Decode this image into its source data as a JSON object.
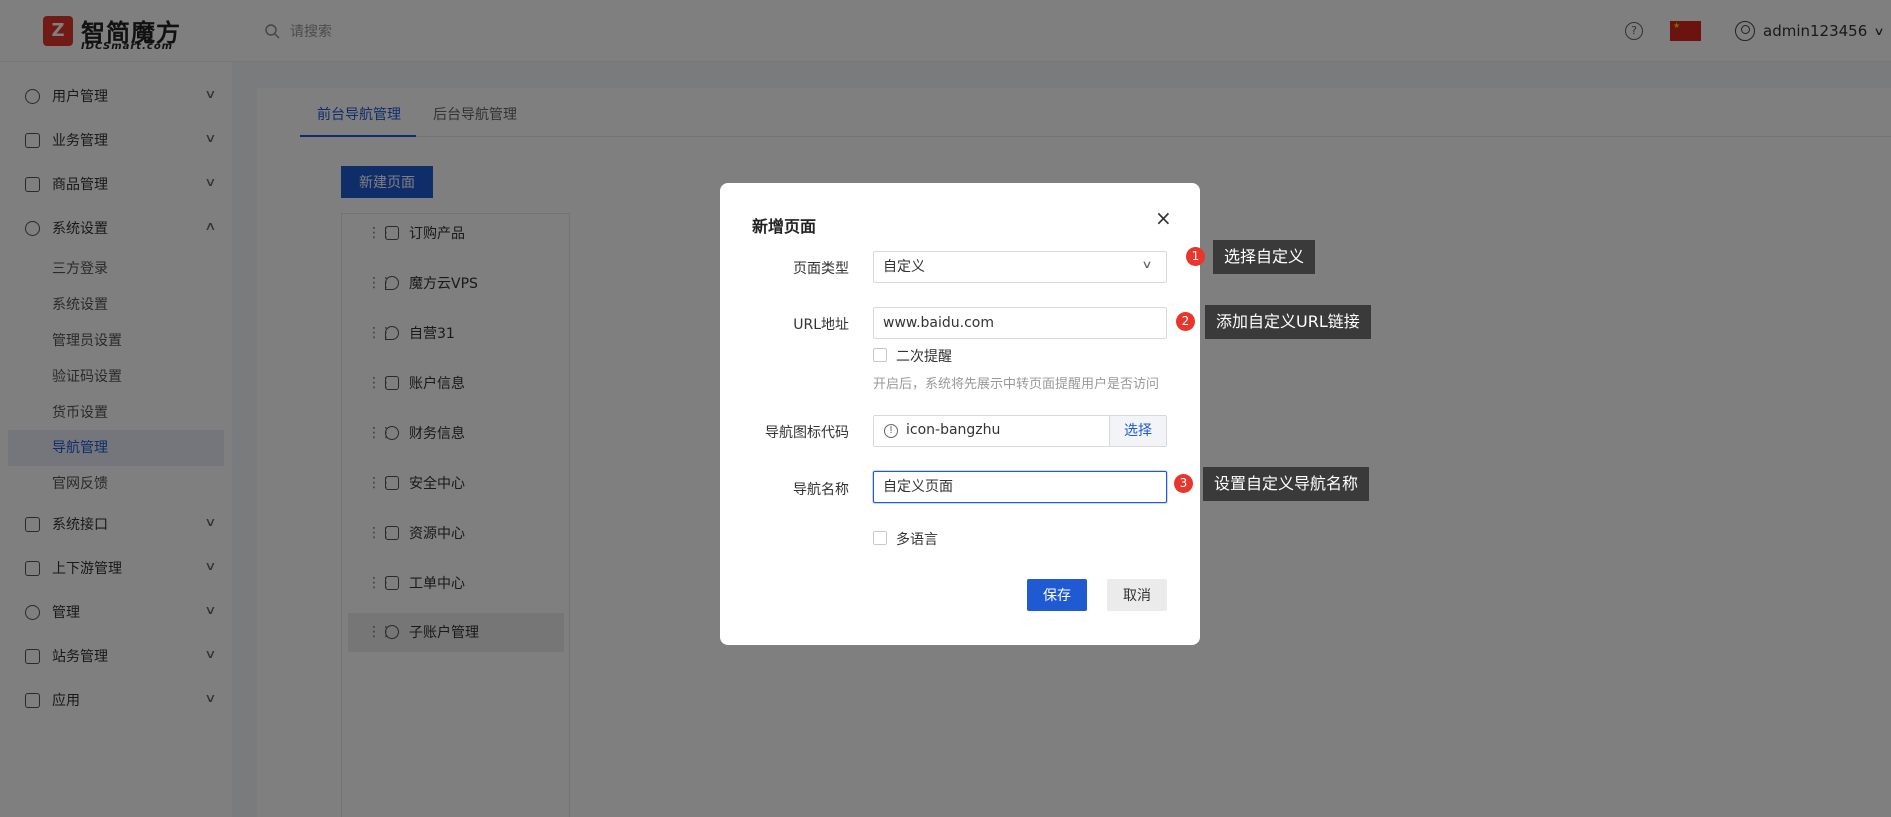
{
  "header": {
    "logo_mark": "Z",
    "logo_text": "智简魔方",
    "logo_sub": "IDCSmart.com",
    "search_placeholder": "请搜索",
    "help_icon": "?",
    "user_name": "admin123456",
    "user_chevron": "∨"
  },
  "sidebar": {
    "items": [
      {
        "label": "用户管理",
        "icon": "user-icon",
        "chevron": "∨"
      },
      {
        "label": "业务管理",
        "icon": "list-icon",
        "chevron": "∨"
      },
      {
        "label": "商品管理",
        "icon": "cart-icon",
        "chevron": "∨"
      },
      {
        "label": "系统设置",
        "icon": "gear-icon",
        "chevron": "∧"
      },
      {
        "label": "系统接口",
        "icon": "folder-icon",
        "chevron": "∨"
      },
      {
        "label": "上下游管理",
        "icon": "network-icon",
        "chevron": "∨"
      },
      {
        "label": "管理",
        "icon": "sun-icon",
        "chevron": "∨"
      },
      {
        "label": "站务管理",
        "icon": "share-icon",
        "chevron": "∨"
      },
      {
        "label": "应用",
        "icon": "cube-icon",
        "chevron": "∨"
      }
    ],
    "sub_items": [
      "三方登录",
      "系统设置",
      "管理员设置",
      "验证码设置",
      "货币设置",
      "导航管理",
      "官网反馈"
    ]
  },
  "tabs": [
    "前台导航管理",
    "后台导航管理"
  ],
  "new_page_button": "新建页面",
  "list_items": [
    "订购产品",
    "魔方云VPS",
    "自营31",
    "账户信息",
    "财务信息",
    "安全中心",
    "资源中心",
    "工单中心",
    "子账户管理"
  ],
  "list_drag_glyph": "⋮⋮",
  "modal": {
    "title": "新增页面",
    "close": "×",
    "page_type_label": "页面类型",
    "page_type_value": "自定义",
    "select_chevron": "∨",
    "url_label": "URL地址",
    "url_value": "www.baidu.com",
    "second_remind_label": "二次提醒",
    "hint": "开启后，系统将先展示中转页面提醒用户是否访问",
    "icon_code_label": "导航图标代码",
    "icon_code_value": "icon-bangzhu",
    "icon_prefix": "!",
    "pick_button": "选择",
    "nav_name_label": "导航名称",
    "nav_name_value": "自定义页面",
    "multi_lang_label": "多语言",
    "save_button": "保存",
    "cancel_button": "取消"
  },
  "annotations": [
    {
      "number": "1",
      "text": "选择自定义"
    },
    {
      "number": "2",
      "text": "添加自定义URL链接"
    },
    {
      "number": "3",
      "text": "设置自定义导航名称"
    }
  ],
  "colors": {
    "accent": "#1f5ad3",
    "badge": "#e8362c",
    "callout_bg": "#3a3a3a",
    "logo": "#e0372c"
  }
}
